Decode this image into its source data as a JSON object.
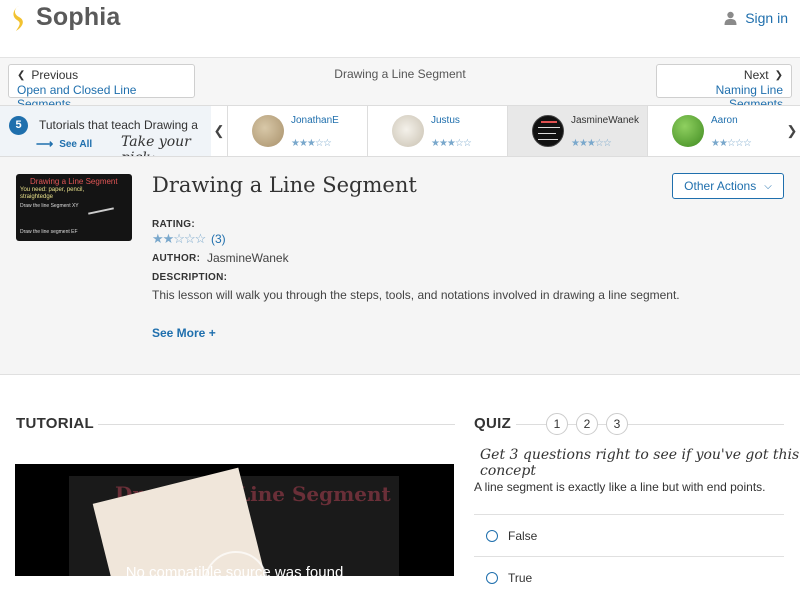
{
  "brand": {
    "name": "Sophia",
    "color": "#f2c230"
  },
  "header": {
    "signin_label": "Sign in"
  },
  "nav": {
    "prev_small": "Previous",
    "prev_title": "Open and Closed Line Segments",
    "center_title": "Drawing a Line Segment",
    "next_small": "Next",
    "next_title": "Naming Line Segments"
  },
  "strip": {
    "count": "5",
    "label": "Tutorials that teach Drawing a Line Segment",
    "see_all": "See All",
    "pick": "Take your pick:",
    "cards": [
      {
        "name": "JonathanE",
        "stars": 3,
        "active": false
      },
      {
        "name": "Justus",
        "stars": 3,
        "active": false
      },
      {
        "name": "JasmineWanek",
        "stars": 3,
        "active": true
      },
      {
        "name": "Aaron",
        "stars": 2,
        "active": false
      }
    ]
  },
  "lesson": {
    "title": "Drawing a Line Segment",
    "other_actions": "Other Actions",
    "rating_label": "RATING:",
    "rating_stars": 2.5,
    "rating_count": "(3)",
    "author_label": "AUTHOR:",
    "author": "JasmineWanek",
    "description_label": "DESCRIPTION:",
    "description": "This lesson will walk you through the steps, tools, and notations involved in drawing a line segment.",
    "see_more": "See More +",
    "thumb_title": "Drawing a Line Segment",
    "thumb_note": "You need: paper, pencil, straightedge",
    "thumb_task1": "Draw the line Segment XY",
    "thumb_task2": "Draw the line segment EF"
  },
  "tutorial": {
    "heading": "TUTORIAL",
    "video_title": "Drawing a Line Segment",
    "video_message": "No compatible source was found"
  },
  "quiz": {
    "heading": "QUIZ",
    "numbers": [
      "1",
      "2",
      "3"
    ],
    "prompt": "Get 3 questions right to see if you've got this concept",
    "question": "A line segment is exactly like a line but with end points.",
    "options": [
      "False",
      "True"
    ]
  },
  "colors": {
    "accent": "#1f6fad",
    "star": "#7aa8cc"
  }
}
